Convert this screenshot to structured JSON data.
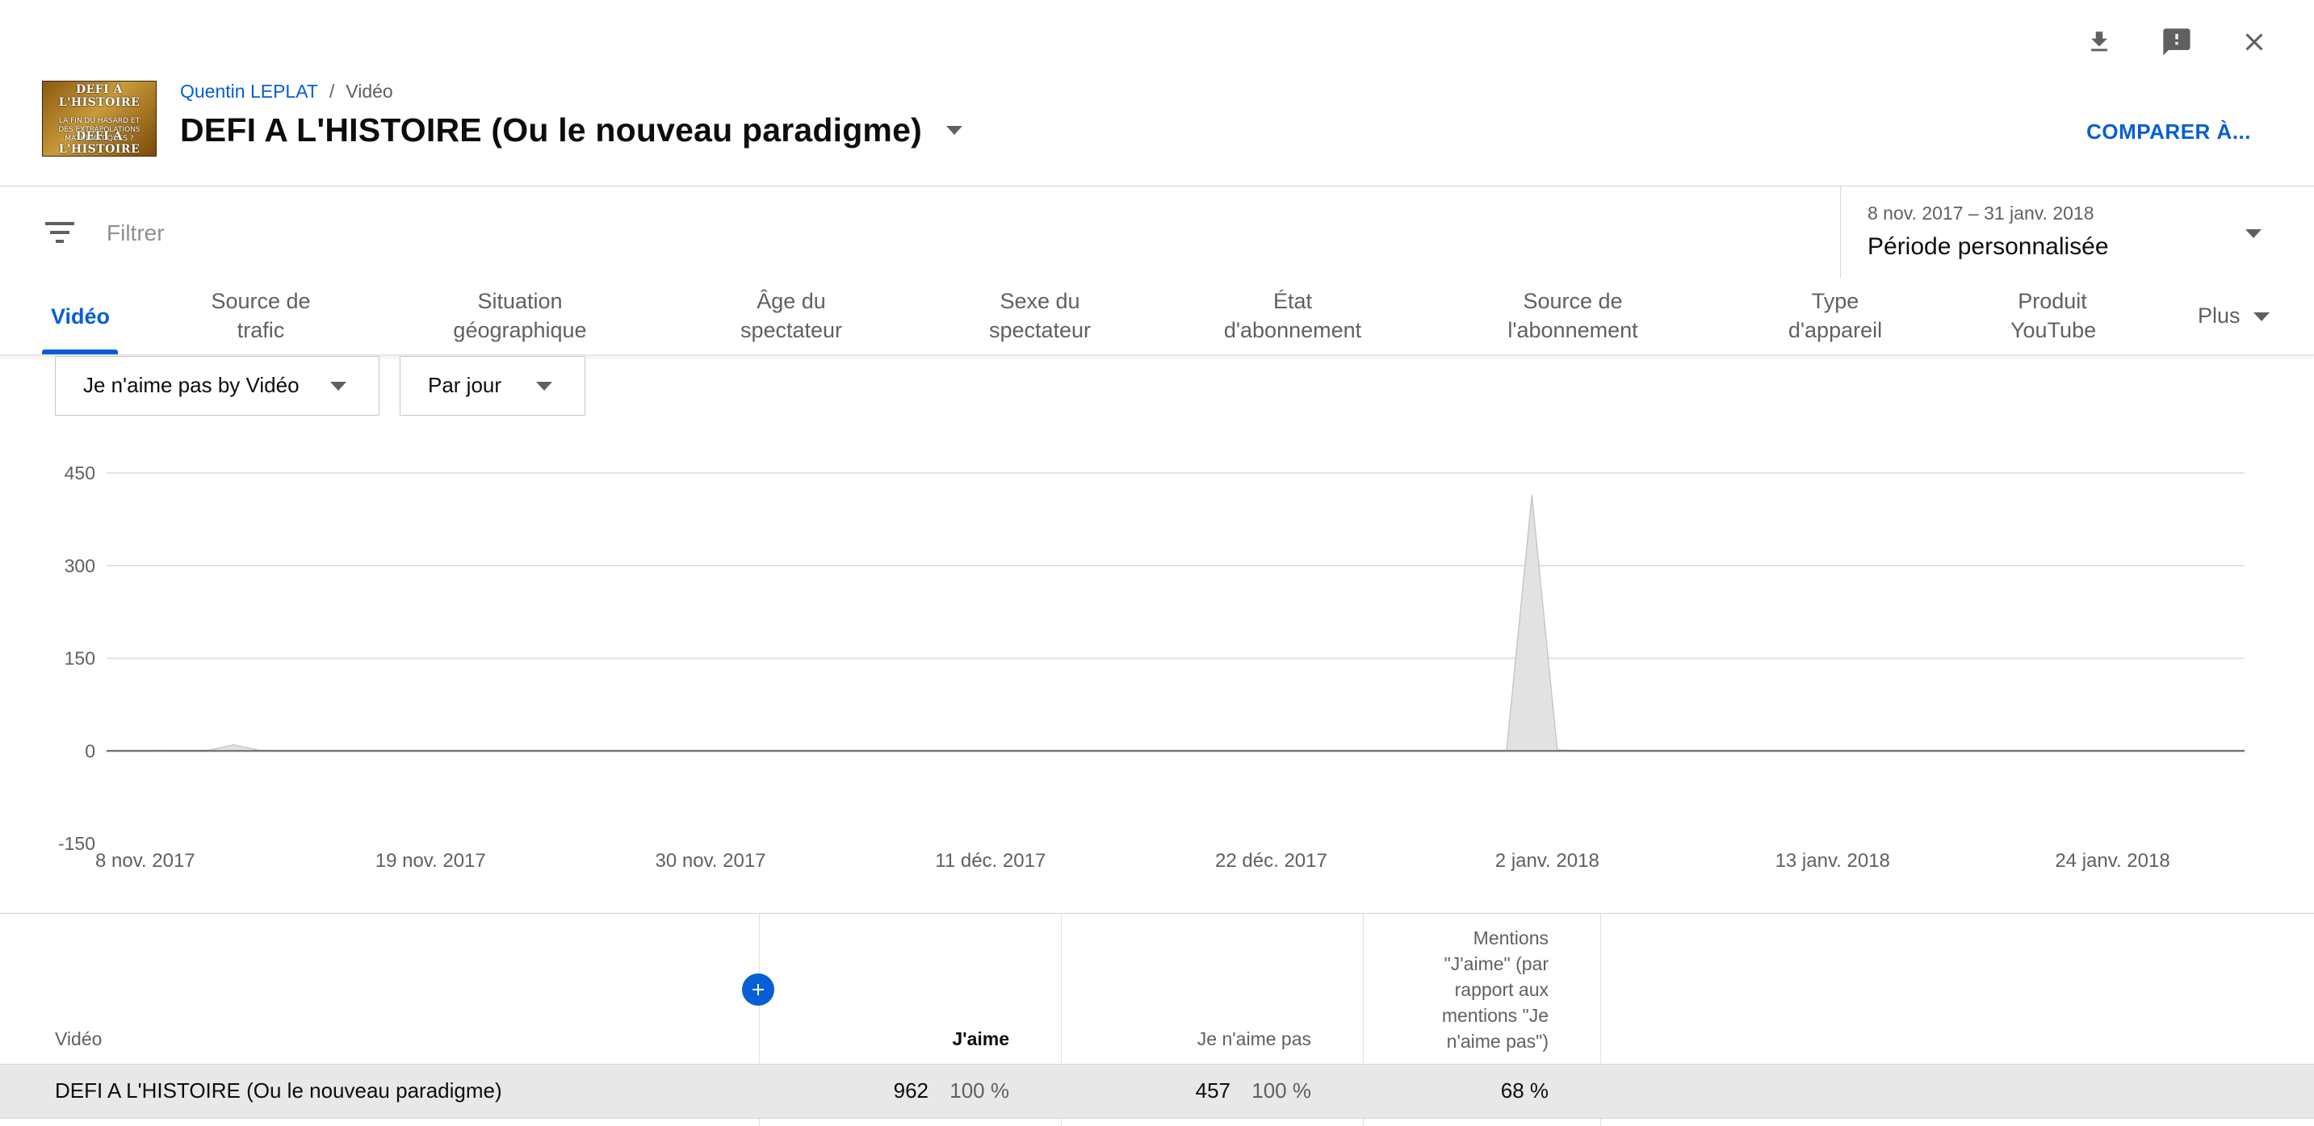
{
  "header": {
    "thumbnail_top_text": "DEFI A L'HISTOIRE",
    "thumbnail_mid_text": "LA FIN DU HASARD ET DES EXTRAPOLATIONS MATHEMATIQUES ?",
    "thumbnail_bottom_text": "DEFI A L'HISTOIRE",
    "channel": "Quentin LEPLAT",
    "crumb_separator": "/",
    "section": "Vidéo",
    "title": "DEFI A L'HISTOIRE (Ou le nouveau paradigme)",
    "compare_label": "COMPARER À..."
  },
  "icons": {
    "download": "download-icon",
    "feedback": "feedback-icon",
    "close": "close-icon",
    "filter": "filter-icon",
    "add": "add-icon"
  },
  "filter": {
    "placeholder": "Filtrer",
    "date_range": "8 nov. 2017 – 31 janv. 2018",
    "period": "Période personnalisée"
  },
  "tabs": [
    {
      "line1": "Vidéo",
      "line2": ""
    },
    {
      "line1": "Source de",
      "line2": "trafic"
    },
    {
      "line1": "Situation",
      "line2": "géographique"
    },
    {
      "line1": "Âge du",
      "line2": "spectateur"
    },
    {
      "line1": "Sexe du",
      "line2": "spectateur"
    },
    {
      "line1": "État",
      "line2": "d'abonnement"
    },
    {
      "line1": "Source de",
      "line2": "l'abonnement"
    },
    {
      "line1": "Type",
      "line2": "d'appareil"
    },
    {
      "line1": "Produit",
      "line2": "YouTube"
    },
    {
      "line1": "Plus",
      "line2": ""
    }
  ],
  "controls": {
    "metric_select": "Je n'aime pas by Vidéo",
    "interval_select": "Par jour"
  },
  "chart_data": {
    "type": "area",
    "title": "",
    "xlabel": "",
    "ylabel": "",
    "ylim": [
      -150,
      450
    ],
    "y_ticks": [
      "450",
      "300",
      "150",
      "0",
      "-150"
    ],
    "x_tick_labels": [
      "8 nov. 2017",
      "19 nov. 2017",
      "30 nov. 2017",
      "11 déc. 2017",
      "22 déc. 2017",
      "2 janv. 2018",
      "13 janv. 2018",
      "24 janv. 2018"
    ],
    "x_start": "2017-11-08",
    "x_end": "2018-01-31",
    "series": [
      {
        "name": "",
        "points": [
          {
            "date": "2017-11-08",
            "value": 0
          },
          {
            "date": "2017-11-12",
            "value": 1
          },
          {
            "date": "2017-11-13",
            "value": 10
          },
          {
            "date": "2017-11-14",
            "value": 1
          },
          {
            "date": "2017-11-15",
            "value": 0
          },
          {
            "date": "2018-01-02",
            "value": 0
          },
          {
            "date": "2018-01-03",
            "value": 415
          },
          {
            "date": "2018-01-04",
            "value": 2
          },
          {
            "date": "2018-01-05",
            "value": 0
          },
          {
            "date": "2018-01-31",
            "value": 0
          }
        ]
      }
    ],
    "colors": {
      "area": "#e2e2e2",
      "line": "#6b6b6b",
      "grid": "#dadada"
    }
  },
  "table": {
    "headers": {
      "video": "Vidéo",
      "likes": "J'aime",
      "dislikes": "Je n'aime pas",
      "ratio": [
        "Mentions",
        "\"J'aime\" (par",
        "rapport aux",
        "mentions \"Je",
        "n'aime pas\")"
      ]
    },
    "rows": [
      {
        "video": "DEFI A L'HISTOIRE (Ou le nouveau paradigme)",
        "likes": "962",
        "likes_pct": "100 %",
        "dislikes": "457",
        "dislikes_pct": "100 %",
        "ratio": "68 %"
      }
    ]
  },
  "colors": {
    "accent": "#065fd4",
    "text": "#0d0d0d",
    "muted": "#606060"
  }
}
